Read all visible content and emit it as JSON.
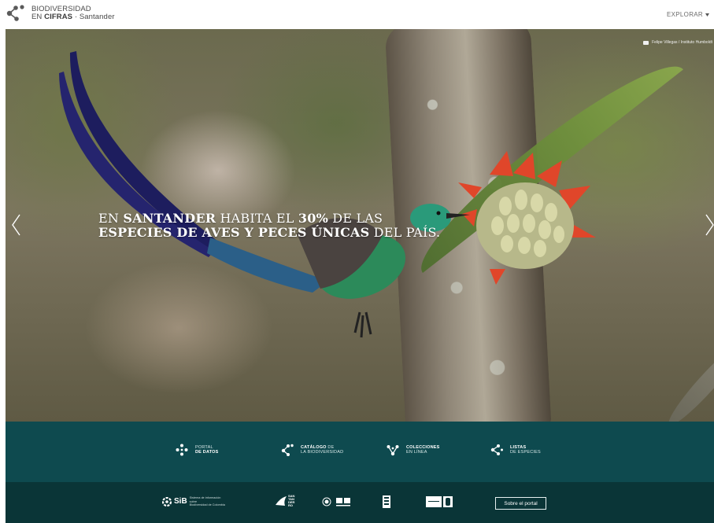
{
  "header": {
    "logo_line1": "BIODIVERSIDAD",
    "logo_line2_prefix": "EN ",
    "logo_line2_bold": "CIFRAS",
    "logo_line2_suffix": " · Santander",
    "explore_label": "EXPLORAR"
  },
  "hero": {
    "title_line1_a": "EN ",
    "title_line1_b": "SANTANDER",
    "title_line1_c": " HABITA EL ",
    "title_line1_d": "30%",
    "title_line1_e": " DE LAS",
    "title_line2_a": "ESPECIES DE AVES Y PECES ÚNICAS",
    "title_line2_b": " DEL PAÍS.",
    "photo_credit": "Felipe Villegas / Instituto Humboldt"
  },
  "nav": [
    {
      "line1": "PORTAL",
      "line2": "DE DATOS",
      "bold_line": 2,
      "icon": "diamond-network-icon"
    },
    {
      "line1_bold": "CATÁLOGO",
      "line1_rest": " DE",
      "line2": "LA BIODIVERSIDAD",
      "icon": "branch-network-icon"
    },
    {
      "line1": "COLECCIONES",
      "line2": "EN LÍNEA",
      "icon": "vee-network-icon"
    },
    {
      "line1": "LISTAS",
      "line2": "DE ESPECIES",
      "icon": "tree-network-icon"
    }
  ],
  "footer": {
    "sib_label": "SiB",
    "sib_desc_line1": "Sistema de información sobre",
    "sib_desc_line2": "Biodiversidad de Colombia",
    "san_label_1": "SAN",
    "san_label_2": "TAN",
    "san_label_3": "DER",
    "san_label_4": "RO",
    "sobre_label": "Sobre el portal"
  },
  "colors": {
    "nav_band": "#0e4a4f",
    "footer": "#0a3537",
    "text_white": "#ffffff"
  }
}
